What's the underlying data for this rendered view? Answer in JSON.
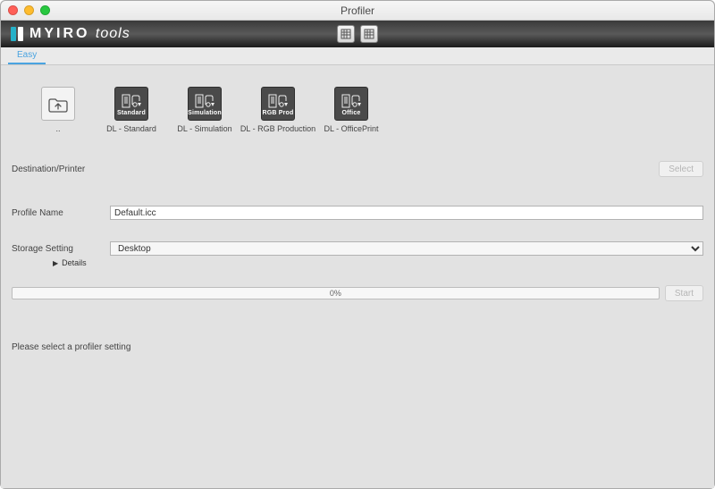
{
  "window": {
    "title": "Profiler"
  },
  "brand": {
    "name_bold": "MYIRO",
    "name_light": "tools"
  },
  "tabs": [
    {
      "label": "Easy",
      "active": true
    }
  ],
  "presets": {
    "up": {
      "caption": ".."
    },
    "items": [
      {
        "tile_label": "Standard",
        "caption": "DL - Standard"
      },
      {
        "tile_label": "Simulation",
        "caption": "DL - Simulation"
      },
      {
        "tile_label": "RGB Prod",
        "caption": "DL - RGB Production"
      },
      {
        "tile_label": "Office",
        "caption": "DL - OfficePrint"
      }
    ]
  },
  "form": {
    "destination": {
      "label": "Destination/Printer",
      "value": "",
      "select_btn": "Select"
    },
    "profile_name": {
      "label": "Profile Name",
      "value": "Default.icc"
    },
    "storage": {
      "label": "Storage Setting",
      "value": "Desktop",
      "details_label": "Details"
    }
  },
  "progress": {
    "text": "0%",
    "start_btn": "Start"
  },
  "status": {
    "message": "Please select a profiler setting"
  }
}
